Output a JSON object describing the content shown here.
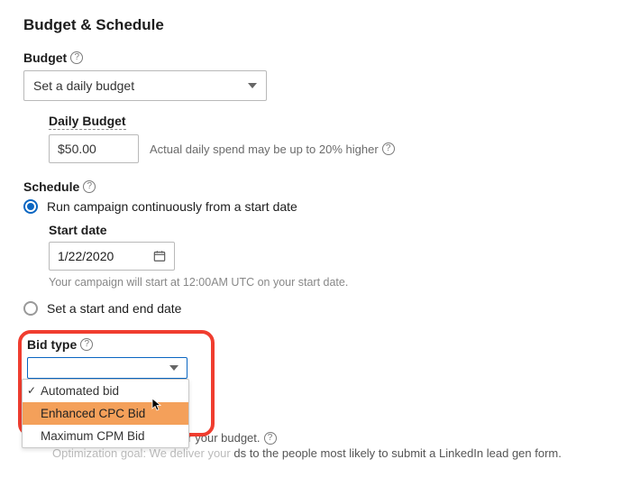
{
  "title": "Budget & Schedule",
  "budget": {
    "label": "Budget",
    "selectValue": "Set a daily budget",
    "dailyBudgetLabel": "Daily Budget",
    "dailyBudgetValue": "$50.00",
    "hint": "Actual daily spend may be up to 20% higher"
  },
  "schedule": {
    "label": "Schedule",
    "option1": "Run campaign continuously from a start date",
    "option2": "Set a start and end date",
    "startDateLabel": "Start date",
    "startDateValue": "1/22/2020",
    "startDateHint": "Your campaign will start at 12:00AM UTC on your start date."
  },
  "bid": {
    "label": "Bid type",
    "options": [
      "Automated bid",
      "Enhanced CPC Bid",
      "Maximum CPM Bid"
    ],
    "line1a": "m bid to get more leads for your budget.",
    "line2a": "Optimization goal: We deliver your",
    "line2b": "ds to the people most likely to submit a LinkedIn lead gen form."
  }
}
